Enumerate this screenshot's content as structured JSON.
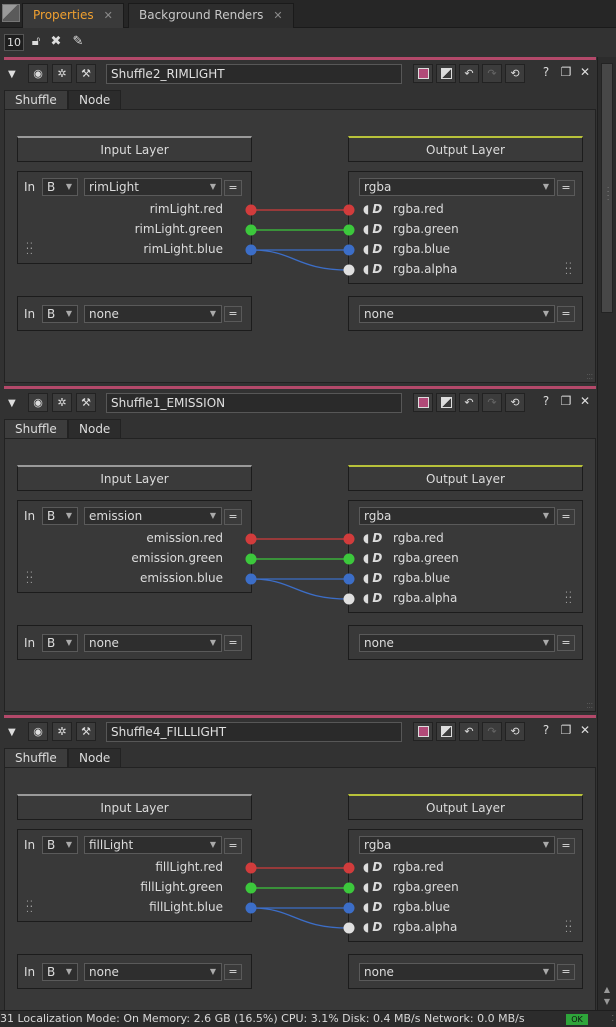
{
  "tabs": [
    {
      "label": "Properties",
      "active": true
    },
    {
      "label": "Background Renders",
      "active": false
    }
  ],
  "toolbar": {
    "max_panels": "10"
  },
  "panels": [
    {
      "name": "Shuffle2_RIMLIGHT",
      "tabs": [
        "Shuffle",
        "Node"
      ],
      "input_header": "Input Layer",
      "output_header": "Output Layer",
      "in_label": "In",
      "input1": {
        "source": "B",
        "layer": "rimLight",
        "channels": [
          "rimLight.red",
          "rimLight.green",
          "rimLight.blue"
        ]
      },
      "output1": {
        "layer": "rgba",
        "channels": [
          "rgba.red",
          "rgba.green",
          "rgba.blue",
          "rgba.alpha"
        ]
      },
      "input2": {
        "source": "B",
        "layer": "none"
      },
      "output2": {
        "layer": "none"
      },
      "eq": "="
    },
    {
      "name": "Shuffle1_EMISSION",
      "tabs": [
        "Shuffle",
        "Node"
      ],
      "input_header": "Input Layer",
      "output_header": "Output Layer",
      "in_label": "In",
      "input1": {
        "source": "B",
        "layer": "emission",
        "channels": [
          "emission.red",
          "emission.green",
          "emission.blue"
        ]
      },
      "output1": {
        "layer": "rgba",
        "channels": [
          "rgba.red",
          "rgba.green",
          "rgba.blue",
          "rgba.alpha"
        ]
      },
      "input2": {
        "source": "B",
        "layer": "none"
      },
      "output2": {
        "layer": "none"
      },
      "eq": "="
    },
    {
      "name": "Shuffle4_FILLLIGHT",
      "tabs": [
        "Shuffle",
        "Node"
      ],
      "input_header": "Input Layer",
      "output_header": "Output Layer",
      "in_label": "In",
      "input1": {
        "source": "B",
        "layer": "fillLight",
        "channels": [
          "fillLight.red",
          "fillLight.green",
          "fillLight.blue"
        ]
      },
      "output1": {
        "layer": "rgba",
        "channels": [
          "rgba.red",
          "rgba.green",
          "rgba.blue",
          "rgba.alpha"
        ]
      },
      "input2": {
        "source": "B",
        "layer": "none"
      },
      "output2": {
        "layer": "none"
      },
      "eq": "="
    }
  ],
  "channel_colors": {
    "red": "#d23c3c",
    "green": "#3cc83c",
    "blue": "#3c6ec8",
    "alpha": "#e0e0e0"
  },
  "accent": {
    "tab_active": "#f0a030",
    "node_line": "#b3496a",
    "output_line": "#b8c23a"
  },
  "header_icons": [
    "viewer-icon",
    "bug-icon",
    "wrench-icon",
    "node-color-icon",
    "split-icon",
    "undo-icon",
    "redo-icon",
    "revert-icon",
    "help-icon",
    "float-icon",
    "close-icon"
  ],
  "status": {
    "text": "31  Localization Mode: On  Memory: 2.6 GB (16.5%)  CPU: 3.1%  Disk: 0.4 MB/s  Network: 0.0 MB/s",
    "ok": "OK"
  }
}
